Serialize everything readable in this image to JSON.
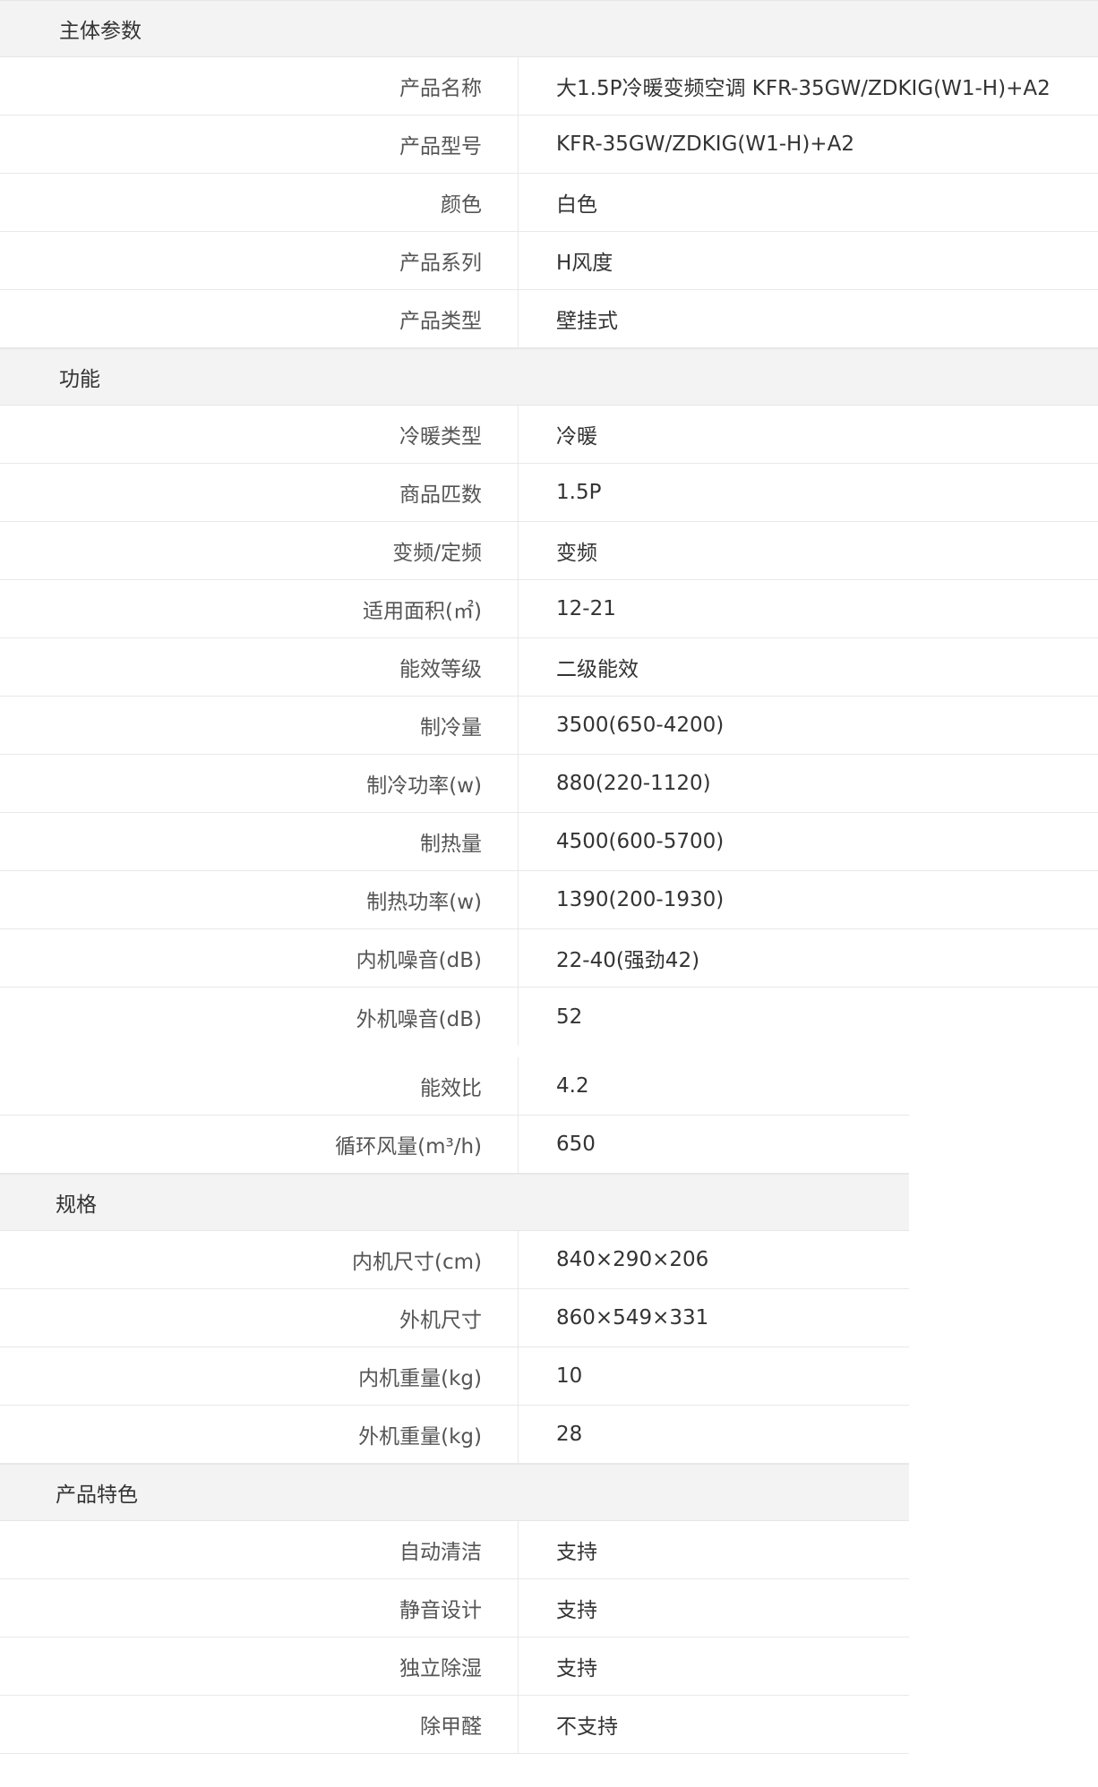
{
  "sections": [
    {
      "title": "主体参数",
      "rows": [
        {
          "label": "产品名称",
          "value": "大1.5P冷暖变频空调 KFR-35GW/ZDKIG(W1-H)+A2"
        },
        {
          "label": "产品型号",
          "value": "KFR-35GW/ZDKIG(W1-H)+A2"
        },
        {
          "label": "颜色",
          "value": "白色"
        },
        {
          "label": "产品系列",
          "value": "H风度"
        },
        {
          "label": "产品类型",
          "value": "壁挂式"
        }
      ]
    },
    {
      "title": "功能",
      "rows": [
        {
          "label": "冷暖类型",
          "value": "冷暖"
        },
        {
          "label": "商品匹数",
          "value": "1.5P"
        },
        {
          "label": "变频/定频",
          "value": "变频"
        },
        {
          "label": "适用面积(㎡)",
          "value": "12-21"
        },
        {
          "label": "能效等级",
          "value": "二级能效"
        },
        {
          "label": "制冷量",
          "value": "3500(650-4200)"
        },
        {
          "label": "制冷功率(w)",
          "value": "880(220-1120)"
        },
        {
          "label": "制热量",
          "value": "4500(600-5700)"
        },
        {
          "label": "制热功率(w)",
          "value": "1390(200-1930)"
        },
        {
          "label": "内机噪音(dB)",
          "value": "22-40(强劲42)"
        },
        {
          "label": "外机噪音(dB)",
          "value": "52"
        },
        {
          "label": "能效比",
          "value": "4.2"
        },
        {
          "label": "循环风量(m³/h)",
          "value": "650"
        }
      ]
    },
    {
      "title": "规格",
      "rows": [
        {
          "label": "内机尺寸(cm)",
          "value": "840×290×206"
        },
        {
          "label": "外机尺寸",
          "value": "860×549×331"
        },
        {
          "label": "内机重量(kg)",
          "value": "10"
        },
        {
          "label": "外机重量(kg)",
          "value": "28"
        }
      ]
    },
    {
      "title": "产品特色",
      "rows": [
        {
          "label": "自动清洁",
          "value": "支持"
        },
        {
          "label": "静音设计",
          "value": "支持"
        },
        {
          "label": "独立除湿",
          "value": "支持"
        },
        {
          "label": "除甲醛",
          "value": "不支持"
        }
      ]
    }
  ]
}
